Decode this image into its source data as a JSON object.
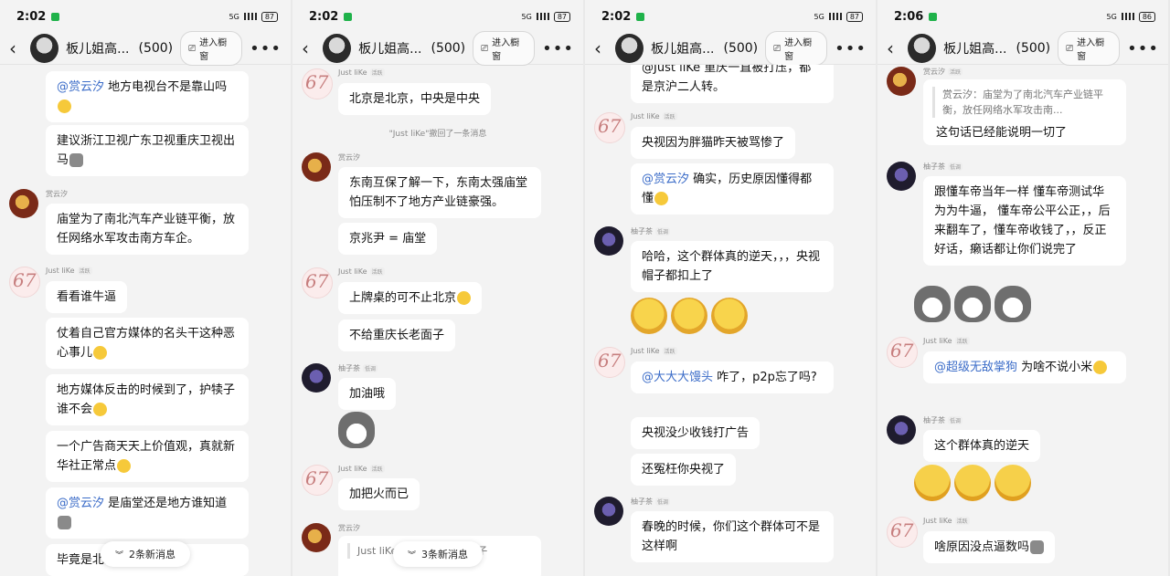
{
  "panels": [
    {
      "status": {
        "time": "2:02",
        "battery": "87",
        "network": "5G"
      },
      "header": {
        "title": "板儿姐高...",
        "count": "(500)",
        "shop_label": "进入橱窗"
      },
      "new_messages": "2条新消息",
      "messages": [
        {
          "type": "bubble",
          "mention": "@赏云汐",
          "text": " 地方电视台不是靠山吗"
        },
        {
          "type": "bubble",
          "text": "建议浙江卫视广东卫视重庆卫视出马"
        },
        {
          "type": "nick",
          "name": "赏云汐",
          "tag": ""
        },
        {
          "type": "bubble",
          "text": "庙堂为了南北汽车产业链平衡，放任网络水军攻击南方车企。"
        },
        {
          "type": "nick",
          "name": "Just liKe",
          "tag": "活跃"
        },
        {
          "type": "bubble",
          "text": "看看谁牛逼"
        },
        {
          "type": "bubble",
          "text": "仗着自己官方媒体的名头干这种恶心事儿"
        },
        {
          "type": "bubble",
          "text": "地方媒体反击的时候到了，护犊子谁不会"
        },
        {
          "type": "bubble",
          "text": "一个广告商天天上价值观，真就新华社正常点"
        },
        {
          "type": "bubble",
          "mention": "@赏云汐",
          "text": " 是庙堂还是地方谁知道"
        },
        {
          "type": "bubble",
          "text": "毕竟是北京朱雀计划"
        }
      ]
    },
    {
      "status": {
        "time": "2:02",
        "battery": "87",
        "network": "5G"
      },
      "header": {
        "title": "板儿姐高...",
        "count": "(500)",
        "shop_label": "进入橱窗"
      },
      "new_messages": "3条新消息",
      "messages": [
        {
          "type": "nick",
          "name": "Just liKe",
          "tag": "活跃"
        },
        {
          "type": "bubble",
          "text": "北京是北京，中央是中央"
        },
        {
          "type": "sys",
          "text": "\"Just liKe\"撤回了一条消息"
        },
        {
          "type": "nick",
          "name": "赏云汐",
          "tag": ""
        },
        {
          "type": "bubble",
          "text": "东南互保了解一下，东南太强庙堂怕压制不了地方产业链豪强。"
        },
        {
          "type": "bubble",
          "text": "京兆尹 = 庙堂"
        },
        {
          "type": "nick",
          "name": "Just liKe",
          "tag": "活跃"
        },
        {
          "type": "bubble",
          "text": "上牌桌的可不止北京"
        },
        {
          "type": "bubble",
          "text": "不给重庆长老面子"
        },
        {
          "type": "nick",
          "name": "柚子茶",
          "tag": "低调"
        },
        {
          "type": "bubble",
          "text": "加油哦"
        },
        {
          "type": "nick",
          "name": "Just liKe",
          "tag": "活跃"
        },
        {
          "type": "bubble",
          "text": "加把火而已"
        },
        {
          "type": "nick",
          "name": "赏云汐",
          "tag": ""
        },
        {
          "type": "quote",
          "text": "Just liKe：不给重庆长老面子"
        }
      ]
    },
    {
      "status": {
        "time": "2:02",
        "battery": "87",
        "network": "5G"
      },
      "header": {
        "title": "板儿姐高...",
        "count": "(500)",
        "shop_label": "进入橱窗"
      },
      "messages": [
        {
          "type": "bubble",
          "text": "@Just liKe 重庆一直被打压，都是京沪二人转。"
        },
        {
          "type": "nick",
          "name": "Just liKe",
          "tag": "活跃"
        },
        {
          "type": "bubble",
          "text": "央视因为胖猫昨天被骂惨了"
        },
        {
          "type": "bubble",
          "mention": "@赏云汐",
          "text": " 确实，历史原因懂得都懂"
        },
        {
          "type": "nick",
          "name": "柚子茶",
          "tag": "低调"
        },
        {
          "type": "bubble",
          "text": "哈哈，这个群体真的逆天，，，央视帽子都扣上了"
        },
        {
          "type": "nick",
          "name": "Just liKe",
          "tag": "活跃"
        },
        {
          "type": "bubble",
          "mention": "@大大大馒头",
          "text": " 咋了，p2p忘了吗?"
        },
        {
          "type": "bubble",
          "text": "央视没少收钱打广告"
        },
        {
          "type": "bubble",
          "text": "还冤枉你央视了"
        },
        {
          "type": "nick",
          "name": "柚子茶",
          "tag": "低调"
        },
        {
          "type": "bubble",
          "text": "春晚的时候，你们这个群体可不是这样啊"
        }
      ]
    },
    {
      "status": {
        "time": "2:06",
        "battery": "86",
        "network": "5G"
      },
      "header": {
        "title": "板儿姐高...",
        "count": "(500)",
        "shop_label": "进入橱窗"
      },
      "messages": [
        {
          "type": "nick",
          "name": "赏云汐",
          "tag": "活跃"
        },
        {
          "type": "quote",
          "text": "赏云汐：庙堂为了南北汽车产业链平衡，放任网络水军攻击南..."
        },
        {
          "type": "bubble",
          "text": "这句话已经能说明一切了"
        },
        {
          "type": "nick",
          "name": "柚子茶",
          "tag": "低调"
        },
        {
          "type": "bubble",
          "text": "跟懂车帝当年一样  懂车帝测试华为为牛逼，  懂车帝公平公正，，后来翻车了，懂车帝收钱了，，反正好话，癞话都让你们说完了"
        },
        {
          "type": "nick",
          "name": "Just liKe",
          "tag": "活跃"
        },
        {
          "type": "bubble",
          "mention": "@超级无敌掌狗",
          "text": " 为啥不说小米"
        },
        {
          "type": "nick",
          "name": "柚子茶",
          "tag": "低调"
        },
        {
          "type": "bubble",
          "text": "这个群体真的逆天"
        },
        {
          "type": "nick",
          "name": "Just liKe",
          "tag": "活跃"
        },
        {
          "type": "bubble",
          "text": "啥原因没点逼数吗"
        }
      ]
    }
  ]
}
